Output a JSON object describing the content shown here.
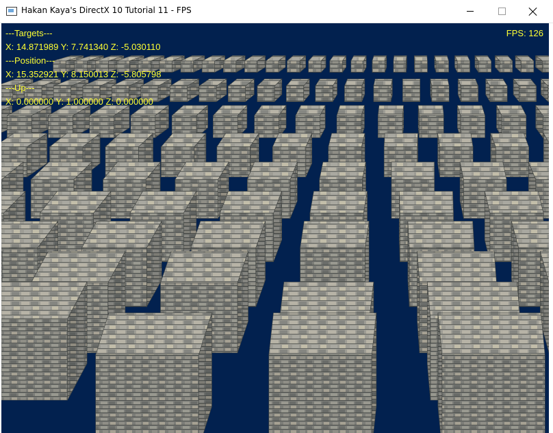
{
  "window": {
    "title": "Hakan Kaya's DirectX 10 Tutorial 11 - FPS",
    "controls": {
      "minimize": "minimize-icon",
      "maximize": "maximize-icon",
      "close": "close-icon"
    }
  },
  "scene": {
    "background_color": "#02214f",
    "cube_texture": "stone-brick",
    "stone_colors": [
      "#8f8f87",
      "#a8a69c",
      "#74746f",
      "#bdb7a6",
      "#5e605f"
    ]
  },
  "hud": {
    "targets_label": "---Targets---",
    "targets_value": "X: 14.871989 Y: 7.741340 Z: -5.030110",
    "position_label": "---Position---",
    "position_value": "X: 15.352921 Y: 8.150013 Z: -5.805798",
    "up_label": "---Up---",
    "up_value": "X: 0.000000 Y: 1.000000 Z: 0.000000",
    "fps": "FPS: 126",
    "text_color": "#ffff33"
  }
}
